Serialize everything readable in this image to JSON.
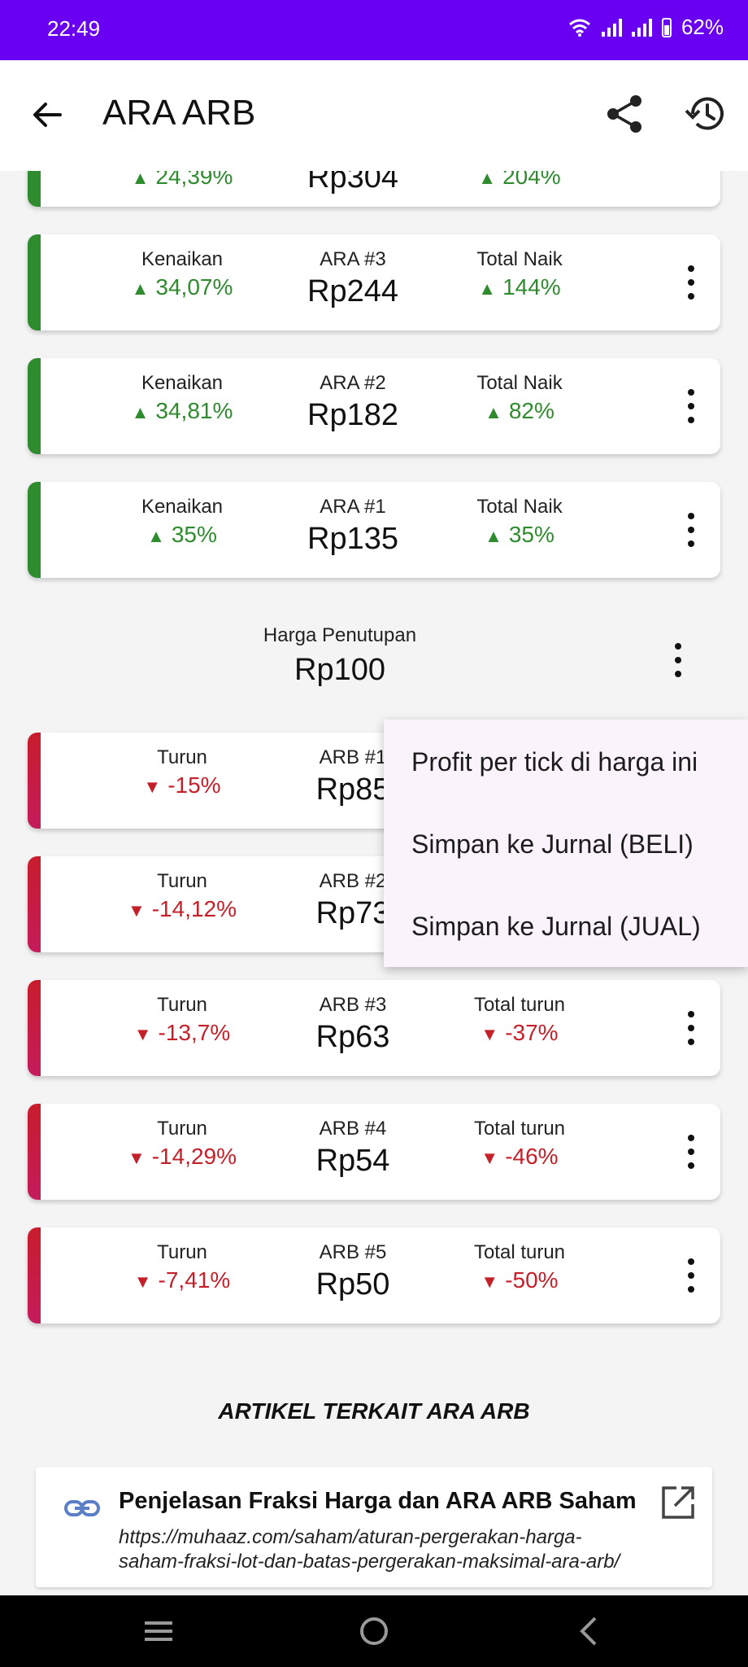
{
  "status": {
    "time": "22:49",
    "battery": "62%"
  },
  "appbar": {
    "title": "ARA ARB"
  },
  "partial_card": {
    "label1": "",
    "value1": "24,39%",
    "price": "Rp304",
    "value3": "204%"
  },
  "ara_cards": [
    {
      "label1": "Kenaikan",
      "value1": "34,07%",
      "label2": "ARA #3",
      "price": "Rp244",
      "label3": "Total Naik",
      "value3": "144%"
    },
    {
      "label1": "Kenaikan",
      "value1": "34,81%",
      "label2": "ARA #2",
      "price": "Rp182",
      "label3": "Total Naik",
      "value3": "82%"
    },
    {
      "label1": "Kenaikan",
      "value1": "35%",
      "label2": "ARA #1",
      "price": "Rp135",
      "label3": "Total Naik",
      "value3": "35%"
    }
  ],
  "closing": {
    "label": "Harga Penutupan",
    "price": "Rp100"
  },
  "arb_cards": [
    {
      "label1": "Turun",
      "value1": "-15%",
      "label2": "ARB #1",
      "price": "Rp85",
      "label3": "",
      "value3": ""
    },
    {
      "label1": "Turun",
      "value1": "-14,12%",
      "label2": "ARB #2",
      "price": "Rp73",
      "label3": "",
      "value3": ""
    },
    {
      "label1": "Turun",
      "value1": "-13,7%",
      "label2": "ARB #3",
      "price": "Rp63",
      "label3": "Total turun",
      "value3": "-37%"
    },
    {
      "label1": "Turun",
      "value1": "-14,29%",
      "label2": "ARB #4",
      "price": "Rp54",
      "label3": "Total turun",
      "value3": "-46%"
    },
    {
      "label1": "Turun",
      "value1": "-7,41%",
      "label2": "ARB #5",
      "price": "Rp50",
      "label3": "Total turun",
      "value3": "-50%"
    }
  ],
  "menu": {
    "items": [
      "Profit per tick di harga ini",
      "Simpan ke Jurnal (BELI)",
      "Simpan ke Jurnal (JUAL)"
    ]
  },
  "articles": {
    "heading": "ARTIKEL TERKAIT ARA ARB",
    "items": [
      {
        "title": "Penjelasan Fraksi Harga dan ARA ARB Saham",
        "url": "https://muhaaz.com/saham/aturan-pergerakan-harga-saham-fraksi-lot-dan-batas-pergerakan-maksimal-ara-arb/"
      }
    ]
  },
  "colors": {
    "statusbar": "#6a00f2",
    "up": "#2e8b2e",
    "down": "#c4202a",
    "menu_bg": "#fbf3fb"
  },
  "icons": [
    "back-arrow-icon",
    "share-icon",
    "history-icon",
    "more-vert-icon",
    "link-icon",
    "open-in-new-icon",
    "wifi-icon",
    "signal-icon",
    "battery-icon"
  ]
}
